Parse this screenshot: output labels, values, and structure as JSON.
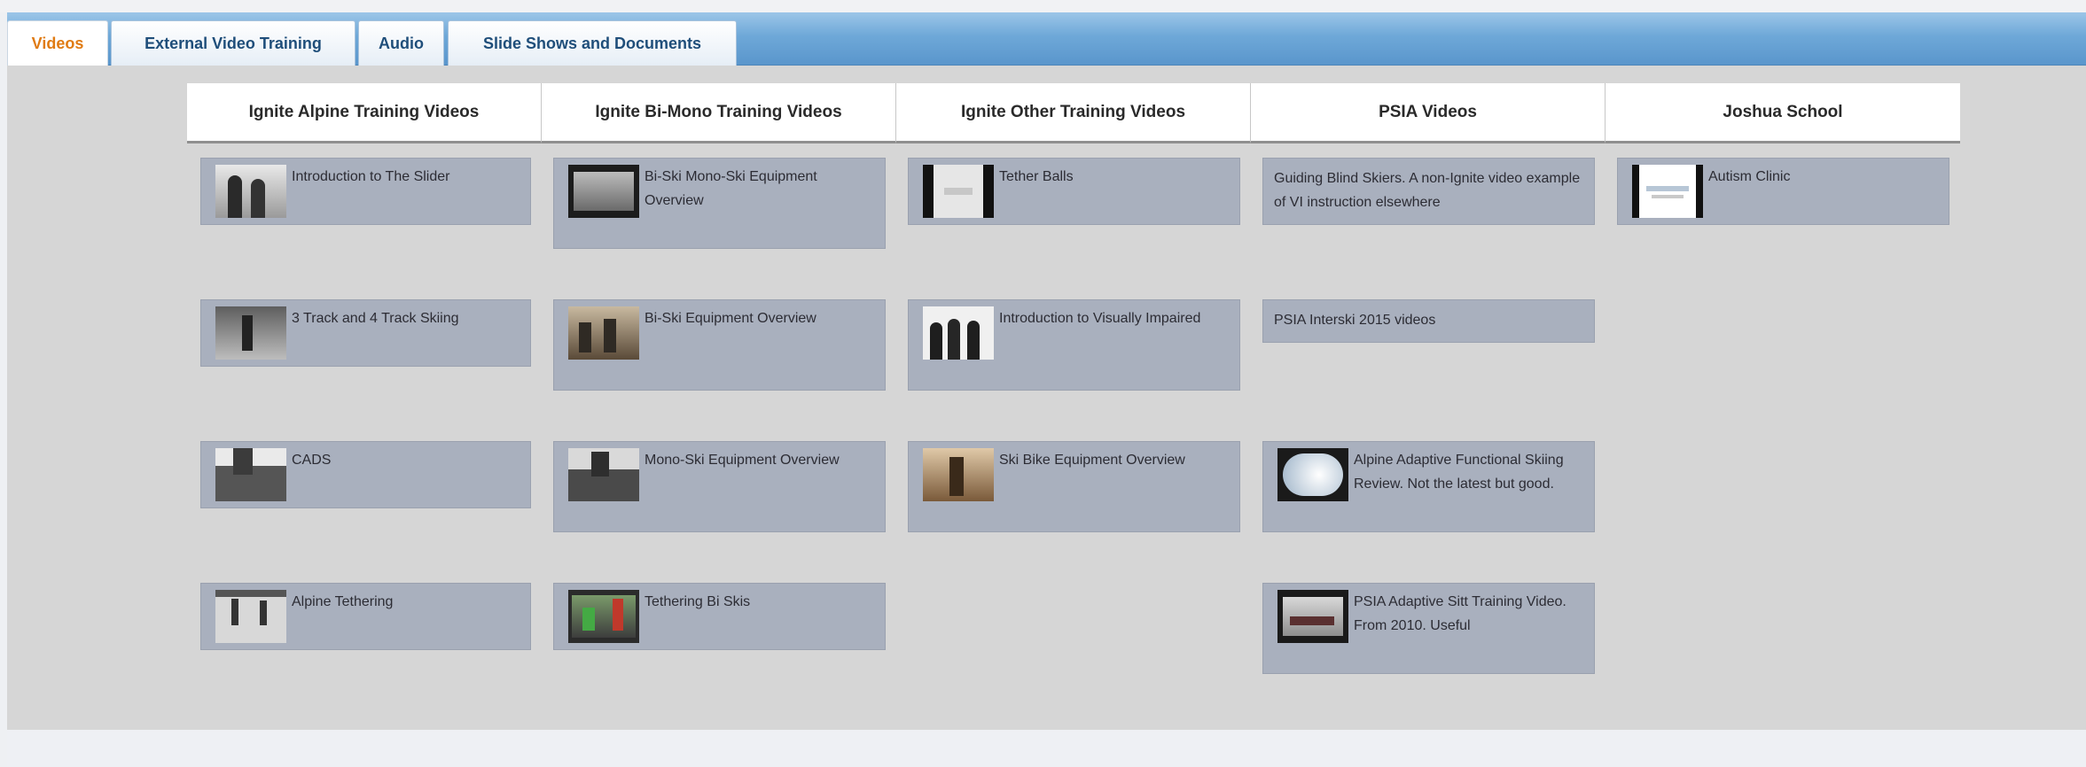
{
  "tabs": [
    {
      "label": "Videos",
      "active": true
    },
    {
      "label": "External Video Training",
      "active": false
    },
    {
      "label": "Audio",
      "active": false
    },
    {
      "label": "Slide Shows and Documents",
      "active": false
    }
  ],
  "columns": [
    {
      "header": "Ignite Alpine Training Videos",
      "items": [
        {
          "title": "Introduction to The Slider",
          "thumb": "two-figures-thumbnail"
        },
        {
          "title": "3 Track and 4 Track Skiing",
          "thumb": "skier-thumbnail"
        },
        {
          "title": "CADS",
          "thumb": "equipment-thumbnail"
        },
        {
          "title": "Alpine Tethering",
          "thumb": "tether-thumbnail"
        }
      ]
    },
    {
      "header": "Ignite Bi-Mono Training Videos",
      "items": [
        {
          "title": "Bi-Ski Mono-Ski Equipment Overview",
          "thumb": "monitor-thumbnail"
        },
        {
          "title": "Bi-Ski Equipment Overview",
          "thumb": "group-thumbnail"
        },
        {
          "title": "Mono-Ski Equipment Overview",
          "thumb": "mono-ski-thumbnail"
        },
        {
          "title": "Tethering Bi Skis",
          "thumb": "tether-bi-thumbnail"
        }
      ]
    },
    {
      "header": "Ignite Other Training Videos",
      "items": [
        {
          "title": "Tether Balls",
          "thumb": "tether-balls-thumbnail"
        },
        {
          "title": "Introduction to Visually Impaired",
          "thumb": "people-thumbnail"
        },
        {
          "title": "Ski Bike Equipment Overview",
          "thumb": "ski-bike-thumbnail"
        }
      ]
    },
    {
      "header": "PSIA Videos",
      "items": [
        {
          "title": "Guiding Blind Skiers. A non-Ignite video example of VI instruction elsewhere",
          "thumb": ""
        },
        {
          "title": "PSIA Interski 2015 videos",
          "thumb": ""
        },
        {
          "title": "Alpine Adaptive Functional Skiing Review. Not the latest but good.",
          "thumb": "snow-thumbnail"
        },
        {
          "title": "PSIA Adaptive Sitt Training Video. From 2010. Useful",
          "thumb": "sit-ski-thumbnail"
        }
      ]
    },
    {
      "header": "Joshua School",
      "items": [
        {
          "title": "Autism Clinic",
          "thumb": "joshua-school-thumbnail"
        }
      ]
    }
  ]
}
